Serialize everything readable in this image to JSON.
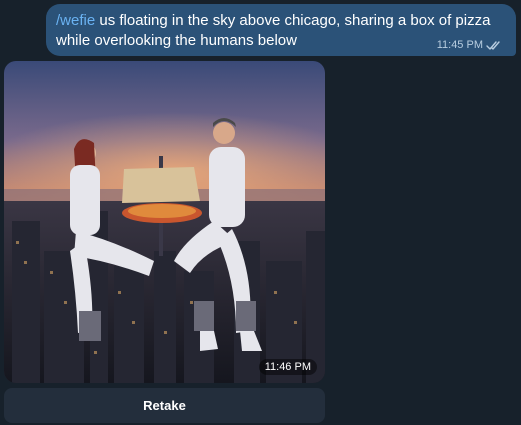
{
  "outgoing_message": {
    "command": "/wefie",
    "text": " us floating in the sky above chicago, sharing a box of pizza while overlooking the humans below",
    "time": "11:45 PM",
    "status_icon": "double-check-icon"
  },
  "incoming_photo": {
    "time": "11:46 PM"
  },
  "inline_keyboard": {
    "retake_label": "Retake"
  },
  "colors": {
    "background": "#17212b",
    "outgoing_bubble": "#2b5278",
    "link": "#6ab2f2",
    "keyboard_button": "#232e3c"
  }
}
